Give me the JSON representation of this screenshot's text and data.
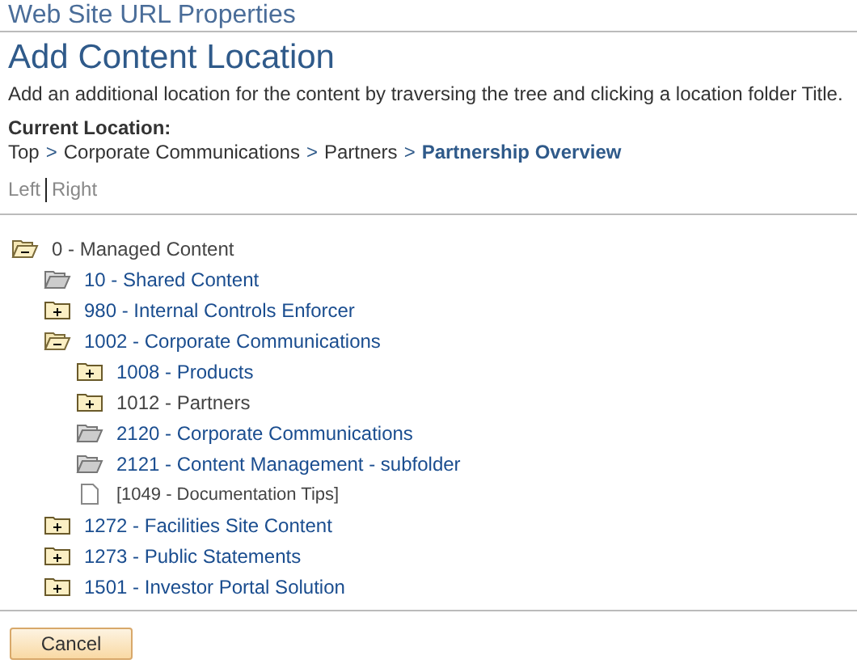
{
  "page_title": "Web Site URL Properties",
  "heading": "Add Content Location",
  "instructions": "Add an additional location for the content by traversing the tree and clicking a location folder Title.",
  "current_location": {
    "label": "Current Location:",
    "path": [
      {
        "kind": "crumb",
        "text": "Top",
        "current": false
      },
      {
        "kind": "separator",
        "text": ">"
      },
      {
        "kind": "crumb",
        "text": "Corporate Communications",
        "current": false
      },
      {
        "kind": "separator",
        "text": ">"
      },
      {
        "kind": "crumb",
        "text": "Partners",
        "current": false
      },
      {
        "kind": "separator",
        "text": ">"
      },
      {
        "kind": "crumb",
        "text": "Partnership Overview",
        "current": true
      }
    ]
  },
  "scroll_links": [
    "Left",
    "Right"
  ],
  "tree": [
    {
      "label": "0 - Managed Content",
      "kind": "collapse",
      "link": false,
      "children": [
        {
          "label": "10 - Shared Content",
          "kind": "open",
          "link": true
        },
        {
          "label": "980 - Internal Controls Enforcer",
          "kind": "expand",
          "link": true
        },
        {
          "label": "1002 - Corporate Communications",
          "kind": "collapse",
          "link": true,
          "children": [
            {
              "label": "1008 - Products",
              "kind": "expand",
              "link": true
            },
            {
              "label": "1012 - Partners",
              "kind": "expand",
              "link": false
            },
            {
              "label": "2120 - Corporate Communications",
              "kind": "open",
              "link": true
            },
            {
              "label": "2121 - Content Management - subfolder",
              "kind": "open",
              "link": true
            },
            {
              "label": "[1049 - Documentation Tips]",
              "kind": "document",
              "link": false
            }
          ]
        },
        {
          "label": "1272 - Facilities Site Content",
          "kind": "expand",
          "link": true
        },
        {
          "label": "1273 - Public Statements",
          "kind": "expand",
          "link": true
        },
        {
          "label": "1501 - Investor Portal Solution",
          "kind": "expand",
          "link": true
        }
      ]
    }
  ],
  "buttons": [
    "Cancel"
  ]
}
